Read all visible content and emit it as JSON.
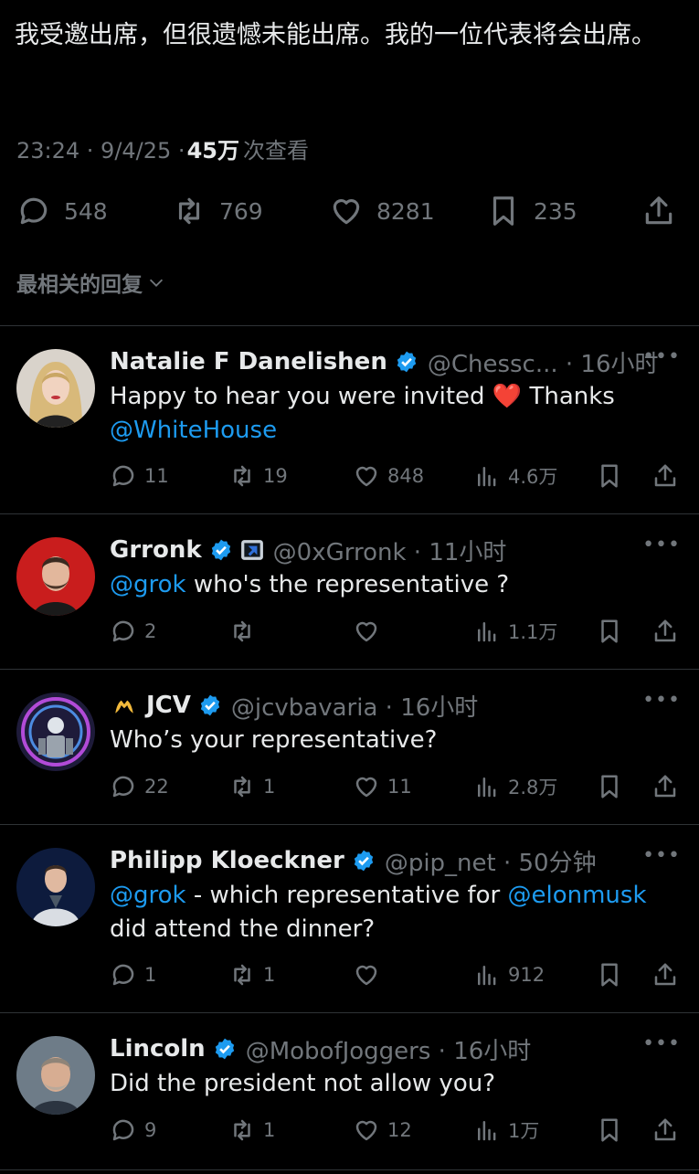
{
  "post": {
    "text": "我受邀出席，但很遗憾未能出席。我的一位代表将会出席。",
    "time": "23:24 · 9/4/25 · ",
    "views_count": "45万",
    "views_label": "次查看",
    "stats": {
      "replies": "548",
      "reposts": "769",
      "likes": "8281",
      "bookmarks": "235"
    }
  },
  "sort_label": "最相关的回复",
  "replies": [
    {
      "name": "Natalie F Danelishen",
      "handle": "@Chessc... · 16小时",
      "text_before": "Happy to hear you were invited ",
      "text_emoji": "❤️",
      "text_after": " Thanks",
      "mention": "@WhiteHouse",
      "stats": {
        "replies": "11",
        "reposts": "19",
        "likes": "848",
        "views": "4.6万"
      }
    },
    {
      "name": "Grronk",
      "handle": "@0xGrronk · 11小时",
      "mention": "@grok",
      "text": " who's the representative ?",
      "stats": {
        "replies": "2",
        "reposts": "",
        "likes": "",
        "views": "1.1万"
      }
    },
    {
      "name": "JCV",
      "handle": "@jcvbavaria · 16小时",
      "text": "Who’s your representative?",
      "stats": {
        "replies": "22",
        "reposts": "1",
        "likes": "11",
        "views": "2.8万"
      }
    },
    {
      "name": "Philipp Kloeckner",
      "handle": "@pip_net · 50分钟",
      "mention": "@grok",
      "text_mid": " - which representative for ",
      "mention2": "@elonmusk",
      "text_line2": "did attend the dinner?",
      "stats": {
        "replies": "1",
        "reposts": "1",
        "likes": "",
        "views": "912"
      }
    },
    {
      "name": "Lincoln",
      "handle": "@MobofJoggers · 16小时",
      "text": "Did the president not allow you?",
      "stats": {
        "replies": "9",
        "reposts": "1",
        "likes": "12",
        "views": "1万"
      }
    }
  ],
  "colors": {
    "background": "#000000",
    "text": "#e7e9ea",
    "muted": "#71767b",
    "link": "#1d9bf0",
    "verified": "#1d9bf0",
    "divider": "#2f3336"
  },
  "icons": [
    "reply-icon",
    "repost-icon",
    "like-icon",
    "bookmark-icon",
    "share-icon",
    "views-icon",
    "verified-icon",
    "more-icon",
    "chevron-down-icon"
  ]
}
